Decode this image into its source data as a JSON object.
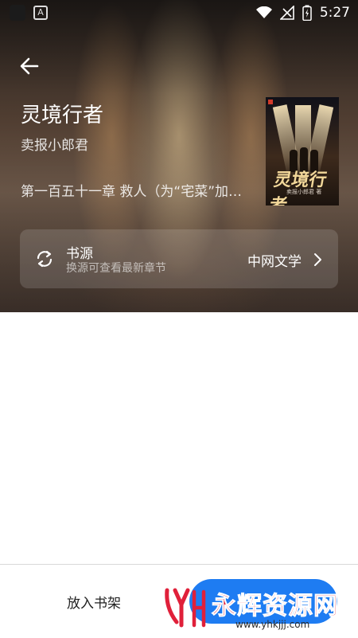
{
  "status_bar": {
    "time": "5:27"
  },
  "book": {
    "title": "灵境行者",
    "author": "卖报小郎君",
    "latest_chapter": "第一百五十一章 救人（为“宅菜”加更）"
  },
  "cover": {
    "title": "灵境行者",
    "author": "卖报小郎君 著"
  },
  "source": {
    "label": "书源",
    "hint": "换源可查看最新章节",
    "name": "中网文学"
  },
  "actions": {
    "add_to_shelf": "放入书架"
  },
  "watermark": {
    "main": "永辉资源网",
    "url": "www.yhkjjj.com"
  },
  "colors": {
    "accent": "#1e7cf2",
    "watermark_red": "#e0203a"
  },
  "icons": [
    "back-arrow-icon",
    "refresh-icon",
    "chevron-right-icon",
    "wifi-icon",
    "signal-icon",
    "battery-icon"
  ]
}
